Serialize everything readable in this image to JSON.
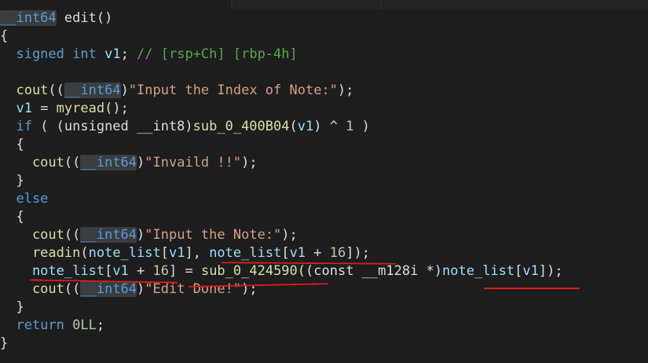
{
  "editor": {
    "lines": [
      {
        "segments": [
          {
            "cls": "kw hl",
            "text": "__int64"
          },
          {
            "cls": "",
            "text": " edit()"
          }
        ]
      },
      {
        "segments": [
          {
            "cls": "",
            "text": "{"
          }
        ]
      },
      {
        "segments": [
          {
            "cls": "kw",
            "text": "  signed int"
          },
          {
            "cls": "",
            "text": " "
          },
          {
            "cls": "id",
            "text": "v1"
          },
          {
            "cls": "",
            "text": "; "
          },
          {
            "cls": "cm",
            "text": "// [rsp+Ch] [rbp-4h]"
          }
        ]
      },
      {
        "segments": [
          {
            "cls": "",
            "text": ""
          }
        ]
      },
      {
        "segments": [
          {
            "cls": "fn",
            "text": "  cout"
          },
          {
            "cls": "",
            "text": "(("
          },
          {
            "cls": "kw hl",
            "text": "__int64"
          },
          {
            "cls": "",
            "text": ")"
          },
          {
            "cls": "str",
            "text": "\"Input the Index of Note:\""
          },
          {
            "cls": "",
            "text": ");"
          }
        ]
      },
      {
        "segments": [
          {
            "cls": "id",
            "text": "  v1"
          },
          {
            "cls": "",
            "text": " = "
          },
          {
            "cls": "fn",
            "text": "myread"
          },
          {
            "cls": "",
            "text": "();"
          }
        ]
      },
      {
        "segments": [
          {
            "cls": "kw",
            "text": "  if"
          },
          {
            "cls": "",
            "text": " ( (unsigned __int8)"
          },
          {
            "cls": "fn",
            "text": "sub_0_400B04"
          },
          {
            "cls": "",
            "text": "("
          },
          {
            "cls": "id",
            "text": "v1"
          },
          {
            "cls": "",
            "text": ") ^ "
          },
          {
            "cls": "num",
            "text": "1"
          },
          {
            "cls": "",
            "text": " )"
          }
        ]
      },
      {
        "segments": [
          {
            "cls": "",
            "text": "  {"
          }
        ]
      },
      {
        "segments": [
          {
            "cls": "fn",
            "text": "    cout"
          },
          {
            "cls": "",
            "text": "(("
          },
          {
            "cls": "kw hl",
            "text": "__int64"
          },
          {
            "cls": "",
            "text": ")"
          },
          {
            "cls": "str",
            "text": "\"Invaild !!\""
          },
          {
            "cls": "",
            "text": ");"
          }
        ]
      },
      {
        "segments": [
          {
            "cls": "",
            "text": "  }"
          }
        ]
      },
      {
        "segments": [
          {
            "cls": "kw",
            "text": "  else"
          }
        ]
      },
      {
        "segments": [
          {
            "cls": "",
            "text": "  {"
          }
        ]
      },
      {
        "segments": [
          {
            "cls": "fn",
            "text": "    cout"
          },
          {
            "cls": "",
            "text": "(("
          },
          {
            "cls": "kw hl",
            "text": "__int64"
          },
          {
            "cls": "",
            "text": ")"
          },
          {
            "cls": "str",
            "text": "\"Input the Note:\""
          },
          {
            "cls": "",
            "text": ");"
          }
        ]
      },
      {
        "segments": [
          {
            "cls": "fn",
            "text": "    readin"
          },
          {
            "cls": "",
            "text": "("
          },
          {
            "cls": "id",
            "text": "note_list"
          },
          {
            "cls": "",
            "text": "["
          },
          {
            "cls": "id",
            "text": "v1"
          },
          {
            "cls": "",
            "text": "], "
          },
          {
            "cls": "id",
            "text": "note_list"
          },
          {
            "cls": "",
            "text": "["
          },
          {
            "cls": "id",
            "text": "v1"
          },
          {
            "cls": "",
            "text": " + "
          },
          {
            "cls": "num",
            "text": "16"
          },
          {
            "cls": "",
            "text": "]);"
          }
        ]
      },
      {
        "segments": [
          {
            "cls": "id",
            "text": "    note_list"
          },
          {
            "cls": "",
            "text": "["
          },
          {
            "cls": "id",
            "text": "v1"
          },
          {
            "cls": "",
            "text": " + "
          },
          {
            "cls": "num",
            "text": "16"
          },
          {
            "cls": "",
            "text": "] = "
          },
          {
            "cls": "fn",
            "text": "sub_0_424590"
          },
          {
            "cls": "",
            "text": "((const __m128i *)"
          },
          {
            "cls": "id",
            "text": "note_list"
          },
          {
            "cls": "",
            "text": "["
          },
          {
            "cls": "id",
            "text": "v1"
          },
          {
            "cls": "",
            "text": "]);"
          }
        ]
      },
      {
        "segments": [
          {
            "cls": "fn",
            "text": "    cout"
          },
          {
            "cls": "",
            "text": "(("
          },
          {
            "cls": "kw hl",
            "text": "__int64"
          },
          {
            "cls": "",
            "text": ")"
          },
          {
            "cls": "str",
            "text": "\"Edit Done!\""
          },
          {
            "cls": "",
            "text": ");"
          }
        ]
      },
      {
        "segments": [
          {
            "cls": "",
            "text": "  }"
          }
        ]
      },
      {
        "segments": [
          {
            "cls": "kw",
            "text": "  return"
          },
          {
            "cls": "",
            "text": " "
          },
          {
            "cls": "num",
            "text": "0LL"
          },
          {
            "cls": "",
            "text": ";"
          }
        ]
      },
      {
        "segments": [
          {
            "cls": "",
            "text": "}"
          }
        ]
      }
    ]
  },
  "colors": {
    "background": "#1e1e1e",
    "keyword": "#569cd6",
    "function": "#dcdcaa",
    "identifier": "#9cdcfe",
    "string": "#d69d85",
    "number": "#b5cea8",
    "comment": "#57a64a",
    "annotation": "#e11b1b"
  }
}
